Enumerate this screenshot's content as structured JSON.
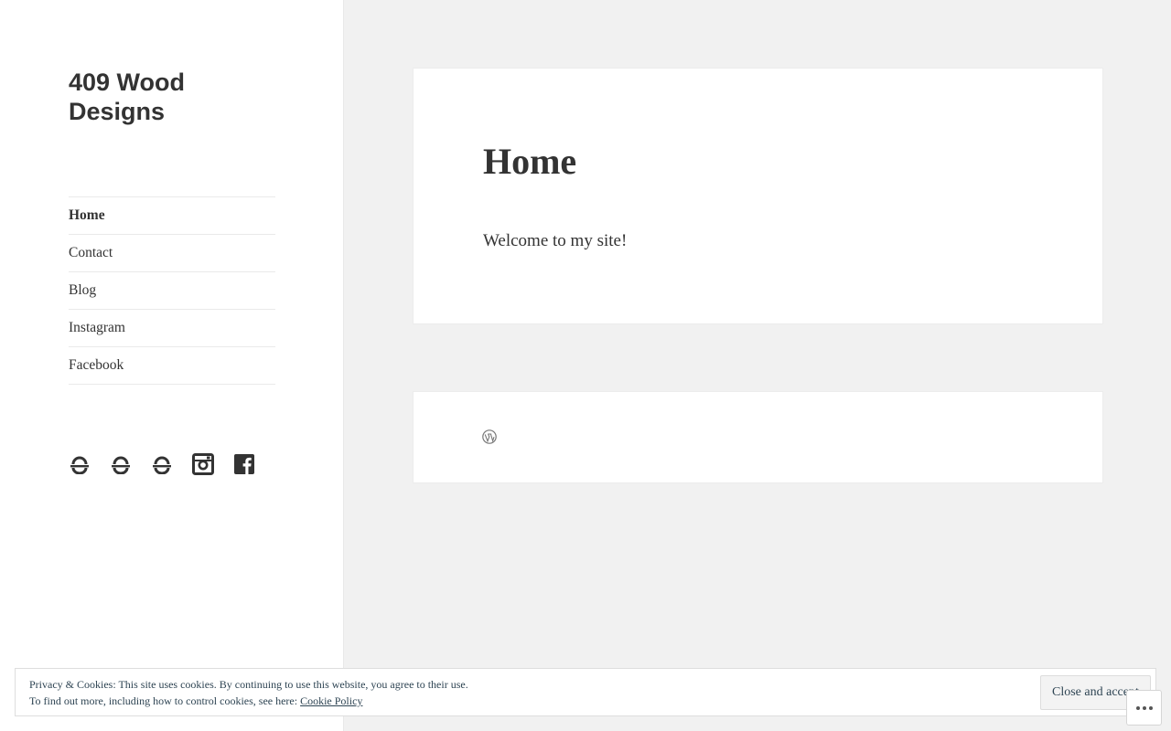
{
  "site": {
    "title": "409 Wood Designs"
  },
  "nav": {
    "items": [
      {
        "label": "Home",
        "current": true
      },
      {
        "label": "Contact",
        "current": false
      },
      {
        "label": "Blog",
        "current": false
      },
      {
        "label": "Instagram",
        "current": false
      },
      {
        "label": "Facebook",
        "current": false
      }
    ]
  },
  "social_icons": [
    "link-icon",
    "link-icon",
    "link-icon",
    "instagram-icon",
    "facebook-icon"
  ],
  "page": {
    "heading": "Home",
    "body": "Welcome to my site!"
  },
  "footer": {
    "logo_icon": "wordpress-icon"
  },
  "cookie_banner": {
    "line1": "Privacy & Cookies: This site uses cookies. By continuing to use this website, you agree to their use.",
    "line2_prefix": "To find out more, including how to control cookies, see here: ",
    "link_label": "Cookie Policy",
    "button_label": "Close and accept"
  },
  "colors": {
    "background": "#f1f1f1",
    "panel": "#ffffff",
    "text": "#333333",
    "cookie_text": "#2e4453"
  }
}
